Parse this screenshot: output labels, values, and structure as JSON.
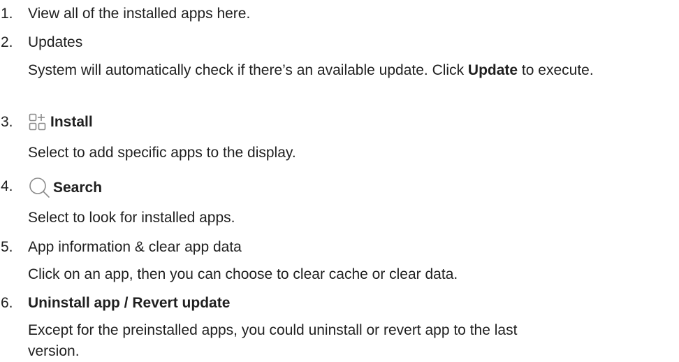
{
  "items": [
    {
      "number": "1.",
      "title": "View all of the installed apps here."
    },
    {
      "number": "2.",
      "title": "Updates",
      "description_before": "System will automatically check if there’s an available update. Click ",
      "description_bold": "Update",
      "description_after": " to execute."
    },
    {
      "number": "3.",
      "title": "Install",
      "icon": "install-apps-icon",
      "description": "Select to add specific apps to the display."
    },
    {
      "number": "4.",
      "title": "Search",
      "icon": "search-icon",
      "description": "Select to look for installed apps."
    },
    {
      "number": "5.",
      "title": "App information & clear app data",
      "description": "Click on an app, then you can choose to clear cache or clear data."
    },
    {
      "number": "6.",
      "title": "Uninstall app / Revert update",
      "description": "Except for the preinstalled apps, you could uninstall or revert app to the last version."
    }
  ],
  "colors": {
    "text": "#1f1f1f",
    "icon": "#8a8a8a"
  }
}
